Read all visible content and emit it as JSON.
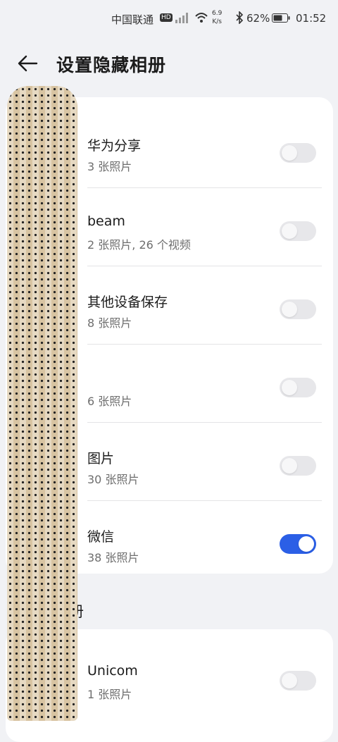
{
  "status_bar": {
    "carrier": "中国联通",
    "hd": "HD",
    "network_speed_value": "6.9",
    "network_speed_unit": "K/s",
    "battery": "62%",
    "time": "01:52"
  },
  "header": {
    "title": "设置隐藏相册"
  },
  "albums": [
    {
      "name": "华为分享",
      "count": "3 张照片",
      "hidden_toggle_on": false
    },
    {
      "name": "beam",
      "count": "2 张照片, 26 个视频",
      "hidden_toggle_on": false
    },
    {
      "name": "其他设备保存",
      "count": "8 张照片",
      "hidden_toggle_on": false
    },
    {
      "name": "",
      "count": "6 张照片",
      "hidden_toggle_on": false
    },
    {
      "name": "图片",
      "count": "30 张照片",
      "hidden_toggle_on": false
    },
    {
      "name": "微信",
      "count": "38 张照片",
      "hidden_toggle_on": true
    }
  ],
  "section2": {
    "title": "册",
    "albums": [
      {
        "name": "Unicom",
        "count": "1 张照片",
        "hidden_toggle_on": false
      }
    ]
  },
  "colors": {
    "toggle_on": "#2b5fe6",
    "toggle_off": "#e7e7ea",
    "background": "#f1f2f5"
  }
}
